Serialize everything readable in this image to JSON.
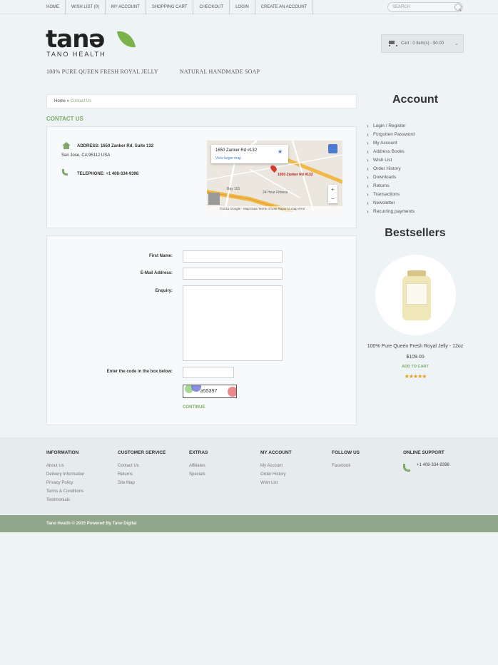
{
  "topnav": [
    "HOME",
    "WISH LIST (0)",
    "MY ACCOUNT",
    "SHOPPING CART",
    "CHECKOUT",
    "LOGIN",
    "CREATE AN ACCOUNT"
  ],
  "search": {
    "placeholder": "SEARCH"
  },
  "logo": {
    "word": "tanə",
    "subtitle": "TANO HEALTH"
  },
  "cart": {
    "text": "Cart : 0 item(s) - $0.00"
  },
  "subnav": [
    "100% PURE QUEEN FRESH ROYAL JELLY",
    "NATURAL HANDMADE SOAP"
  ],
  "breadcrumb": {
    "home": "Home",
    "separator": " » ",
    "current": "Contact Us"
  },
  "page_title": "CONTACT US",
  "contact": {
    "address_line1": "ADDRESS: 1650 Zanker Rd. Suite 132",
    "address_line2": "San Jose, CA 95112 USA",
    "telephone": "TELEPHONE: +1 408-334-9398"
  },
  "map": {
    "card_title": "1650 Zanker Rd #132",
    "card_link": "View larger map",
    "pin_label": "1650 Zanker Rd #132",
    "label_fitness": "24 Hour Fitness",
    "label_bay": "Bay 101",
    "footer": "©2015 Google · Map Data    Terms of Use    Report a map error"
  },
  "form": {
    "first_name_label": "First Name:",
    "email_label": "E-Mail Address:",
    "enquiry_label": "Enquiry:",
    "captcha_label": "Enter the code in the box below:",
    "captcha_code": "a55397",
    "continue_label": "CONTINUE"
  },
  "account": {
    "title": "Account",
    "items": [
      "Login / Register",
      "Forgotten Password",
      "My Account",
      "Address Books",
      "Wish List",
      "Order History",
      "Downloads",
      "Returns",
      "Transactions",
      "Newsletter",
      "Recurring payments"
    ]
  },
  "bestsellers": {
    "title": "Bestsellers",
    "product_name": "100% Pure Queen Fresh Royal Jelly - 12oz",
    "price": "$109.00",
    "add_to_cart": "ADD TO CART",
    "rating": 5,
    "stars": "★★★★★"
  },
  "footer": {
    "information": {
      "title": "INFORMATION",
      "links": [
        "About Us",
        "Delivery Information",
        "Privacy Policy",
        "Terms & Conditions",
        "Testimonials"
      ]
    },
    "customer_service": {
      "title": "CUSTOMER SERVICE",
      "links": [
        "Contact Us",
        "Returns",
        "Site Map"
      ]
    },
    "extras": {
      "title": "EXTRAS",
      "links": [
        "Affiliates",
        "Specials"
      ]
    },
    "my_account": {
      "title": "MY ACCOUNT",
      "links": [
        "My Account",
        "Order History",
        "Wish List"
      ]
    },
    "follow_us": {
      "title": "FOLLOW US",
      "links": [
        "Facebook"
      ]
    },
    "online_support": {
      "title": "ONLINE SUPPORT",
      "phone": "+1 408-334-9398"
    },
    "copyright": "Tano Health © 2015 Powered By Tano Digital"
  },
  "colors": {
    "accent": "#7fa96b",
    "footer_bar": "#90a78a",
    "background": "#eef3f5"
  }
}
